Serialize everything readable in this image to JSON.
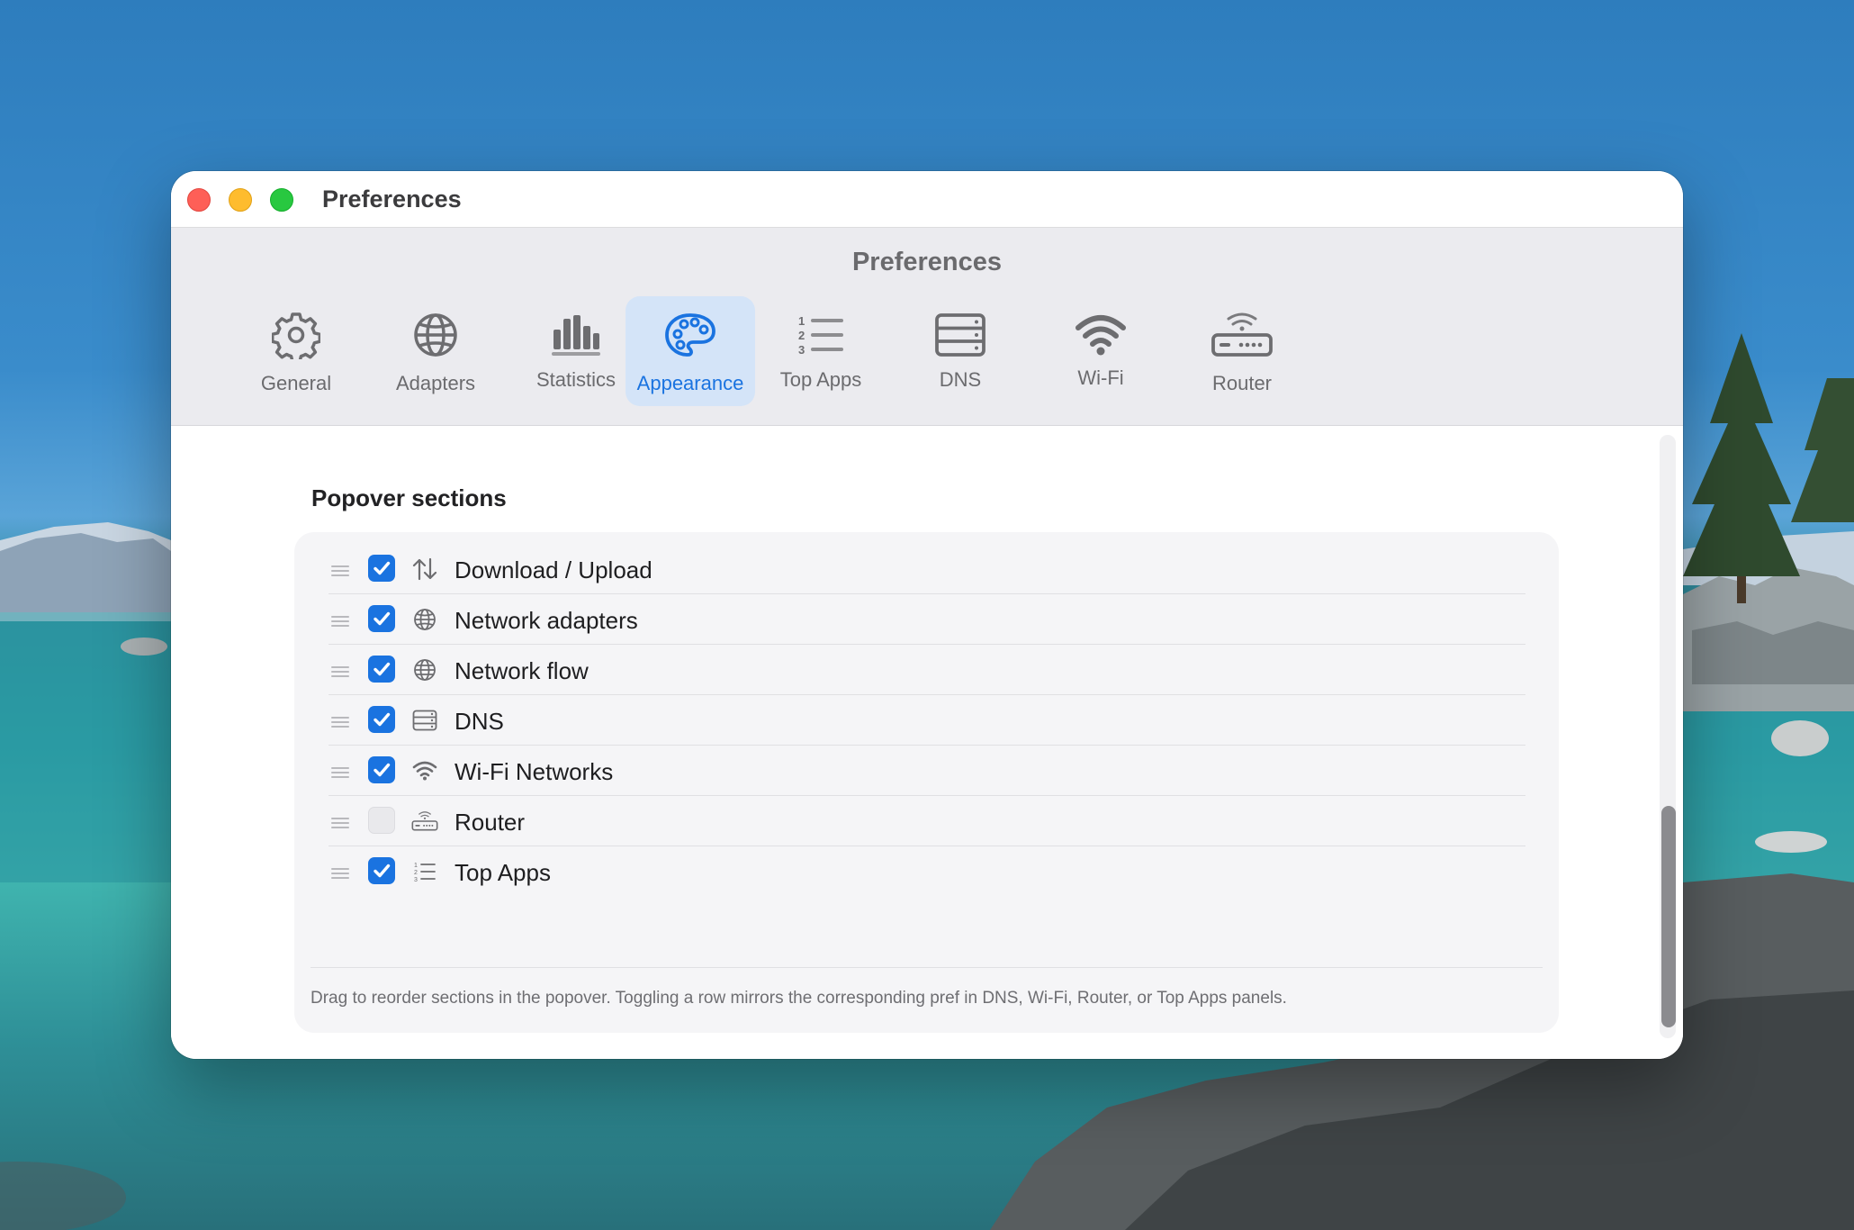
{
  "window": {
    "title": "Preferences",
    "controls": [
      "close",
      "minimize",
      "zoom"
    ]
  },
  "toolbar": {
    "title": "Preferences",
    "tabs": [
      {
        "label": "General",
        "icon": "gear-icon",
        "active": false
      },
      {
        "label": "Adapters",
        "icon": "globe-icon",
        "active": false
      },
      {
        "label": "Statistics",
        "icon": "bar-chart-icon",
        "active": false
      },
      {
        "label": "Appearance",
        "icon": "palette-icon",
        "active": true
      },
      {
        "label": "Top Apps",
        "icon": "numbered-list-icon",
        "active": false
      },
      {
        "label": "DNS",
        "icon": "server-icon",
        "active": false
      },
      {
        "label": "Wi-Fi",
        "icon": "wifi-icon",
        "active": false
      },
      {
        "label": "Router",
        "icon": "router-icon",
        "active": false
      }
    ]
  },
  "content": {
    "section_title": "Popover sections",
    "rows": [
      {
        "label": "Download / Upload",
        "icon": "arrows-up-down-icon",
        "checked": true
      },
      {
        "label": "Network adapters",
        "icon": "globe-icon",
        "checked": true
      },
      {
        "label": "Network flow",
        "icon": "globe-grid-icon",
        "checked": true
      },
      {
        "label": "DNS",
        "icon": "server-icon",
        "checked": true
      },
      {
        "label": "Wi-Fi Networks",
        "icon": "wifi-icon",
        "checked": true
      },
      {
        "label": "Router",
        "icon": "router-icon",
        "checked": false
      },
      {
        "label": "Top Apps",
        "icon": "numbered-list-icon",
        "checked": true
      }
    ],
    "footer_note": "Drag to reorder sections in the popover. Toggling a row mirrors the corresponding pref in DNS, Wi-Fi, Router, or Top Apps panels."
  },
  "colors": {
    "accent": "#1a73e0",
    "active_tab_bg": "#d4e4f8",
    "close": "#fe5f57",
    "minimize": "#febc2e",
    "zoom": "#28c840"
  }
}
